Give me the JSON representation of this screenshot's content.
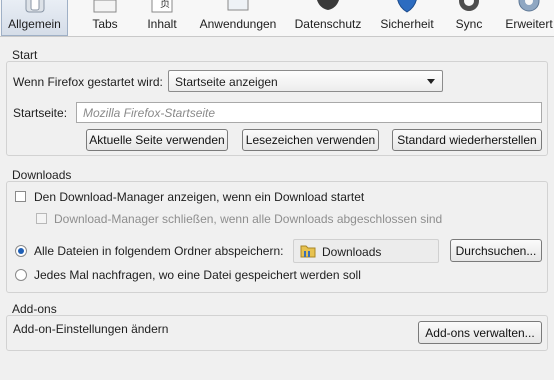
{
  "toolbar": {
    "tabs": [
      {
        "label": "Allgemein",
        "icon": "switch-icon",
        "active": true
      },
      {
        "label": "Tabs",
        "icon": "tabs-icon"
      },
      {
        "label": "Inhalt",
        "icon": "content-icon"
      },
      {
        "label": "Anwendungen",
        "icon": "applications-icon"
      },
      {
        "label": "Datenschutz",
        "icon": "privacy-mask-icon"
      },
      {
        "label": "Sicherheit",
        "icon": "security-icon"
      },
      {
        "label": "Sync",
        "icon": "sync-icon"
      },
      {
        "label": "Erweitert",
        "icon": "gear-icon"
      }
    ]
  },
  "start": {
    "title": "Start",
    "startup_label": "Wenn Firefox gestartet wird:",
    "startup_value": "Startseite anzeigen",
    "homepage_label": "Startseite:",
    "homepage_value": "",
    "homepage_placeholder": "Mozilla Firefox-Startseite",
    "btn_current": "Aktuelle Seite verwenden",
    "btn_bookmark": "Lesezeichen verwenden",
    "btn_restore": "Standard wiederherstellen"
  },
  "downloads": {
    "title": "Downloads",
    "show_manager": "Den Download-Manager anzeigen, wenn ein Download startet",
    "close_manager": "Download-Manager schließen, wenn alle Downloads abgeschlossen sind",
    "save_to_label": "Alle Dateien in folgendem Ordner abspeichern:",
    "folder": "Downloads",
    "browse": "Durchsuchen...",
    "always_ask": "Jedes Mal nachfragen, wo eine Datei gespeichert werden soll"
  },
  "addons": {
    "title": "Add-ons",
    "label": "Add-on-Einstellungen ändern",
    "manage": "Add-ons verwalten..."
  }
}
